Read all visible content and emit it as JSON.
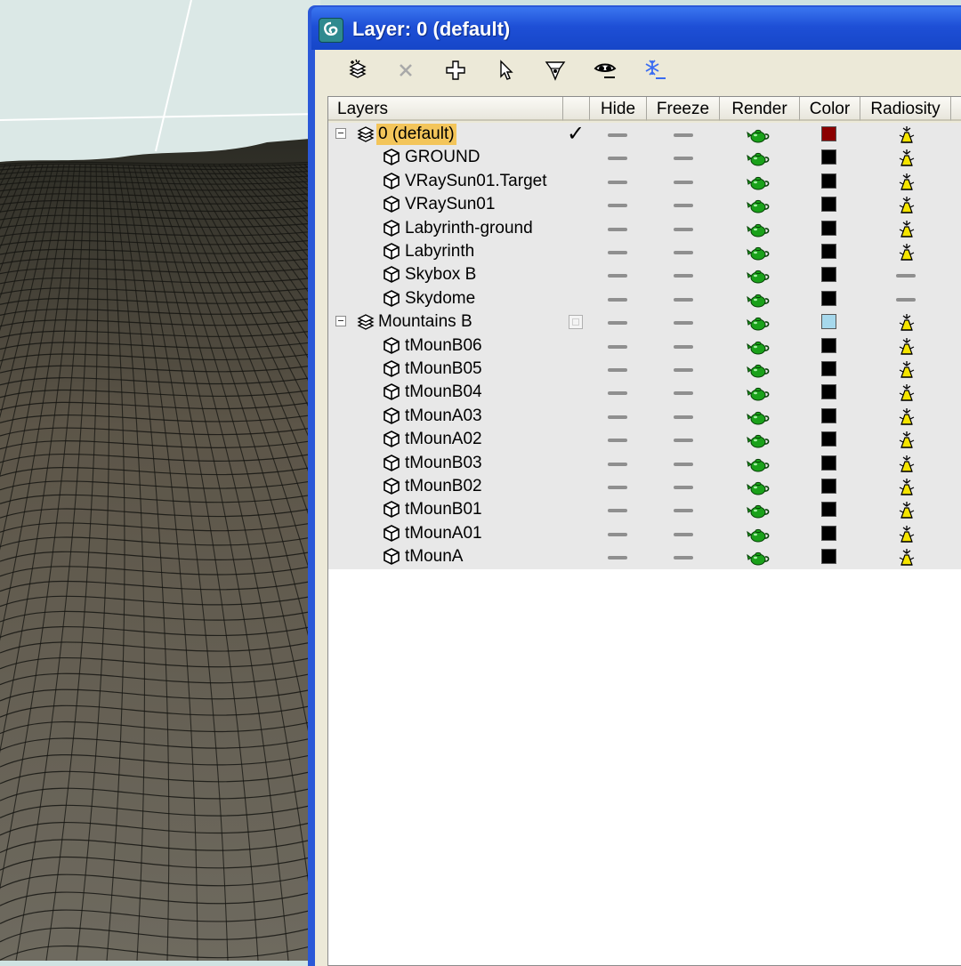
{
  "window": {
    "title": "Layer: 0 (default)"
  },
  "toolbar": [
    {
      "name": "create-layer-icon",
      "enabled": true
    },
    {
      "name": "delete-layer-icon",
      "enabled": false
    },
    {
      "name": "add-to-layer-icon",
      "enabled": true
    },
    {
      "name": "select-objects-icon",
      "enabled": true
    },
    {
      "name": "highlight-layer-icon",
      "enabled": true
    },
    {
      "name": "hide-all-icon",
      "enabled": true
    },
    {
      "name": "freeze-all-icon",
      "enabled": true
    }
  ],
  "columns": {
    "layers": "Layers",
    "hide": "Hide",
    "freeze": "Freeze",
    "render": "Render",
    "color": "Color",
    "radiosity": "Radiosity"
  },
  "rows": [
    {
      "type": "layer",
      "name": "0 (default)",
      "selected": true,
      "current": true,
      "color": "#8b0000",
      "radiosity": true
    },
    {
      "type": "object",
      "name": "GROUND",
      "color": "#000000",
      "radiosity": true
    },
    {
      "type": "object",
      "name": "VRaySun01.Target",
      "color": "#000000",
      "radiosity": true
    },
    {
      "type": "object",
      "name": "VRaySun01",
      "color": "#000000",
      "radiosity": true
    },
    {
      "type": "object",
      "name": "Labyrinth-ground",
      "color": "#000000",
      "radiosity": true
    },
    {
      "type": "object",
      "name": "Labyrinth",
      "color": "#000000",
      "radiosity": true
    },
    {
      "type": "object",
      "name": "Skybox B",
      "color": "#000000",
      "radiosity": false
    },
    {
      "type": "object",
      "name": "Skydome",
      "color": "#000000",
      "radiosity": false
    },
    {
      "type": "layer",
      "name": "Mountains B",
      "selected": false,
      "current": false,
      "color": "#a6d8ec",
      "radiosity": true
    },
    {
      "type": "object",
      "name": "tMounB06",
      "color": "#000000",
      "radiosity": true
    },
    {
      "type": "object",
      "name": "tMounB05",
      "color": "#000000",
      "radiosity": true
    },
    {
      "type": "object",
      "name": "tMounB04",
      "color": "#000000",
      "radiosity": true
    },
    {
      "type": "object",
      "name": "tMounA03",
      "color": "#000000",
      "radiosity": true
    },
    {
      "type": "object",
      "name": "tMounA02",
      "color": "#000000",
      "radiosity": true
    },
    {
      "type": "object",
      "name": "tMounB03",
      "color": "#000000",
      "radiosity": true
    },
    {
      "type": "object",
      "name": "tMounB02",
      "color": "#000000",
      "radiosity": true
    },
    {
      "type": "object",
      "name": "tMounB01",
      "color": "#000000",
      "radiosity": true
    },
    {
      "type": "object",
      "name": "tMounA01",
      "color": "#000000",
      "radiosity": true
    },
    {
      "type": "object",
      "name": "tMounA",
      "color": "#000000",
      "radiosity": true
    }
  ],
  "colors": {
    "titlebar": "#1e4fd6",
    "selection": "#f3c55a",
    "render-teapot": "#1aa11a",
    "radiosity-lamp": "#f5e400"
  }
}
